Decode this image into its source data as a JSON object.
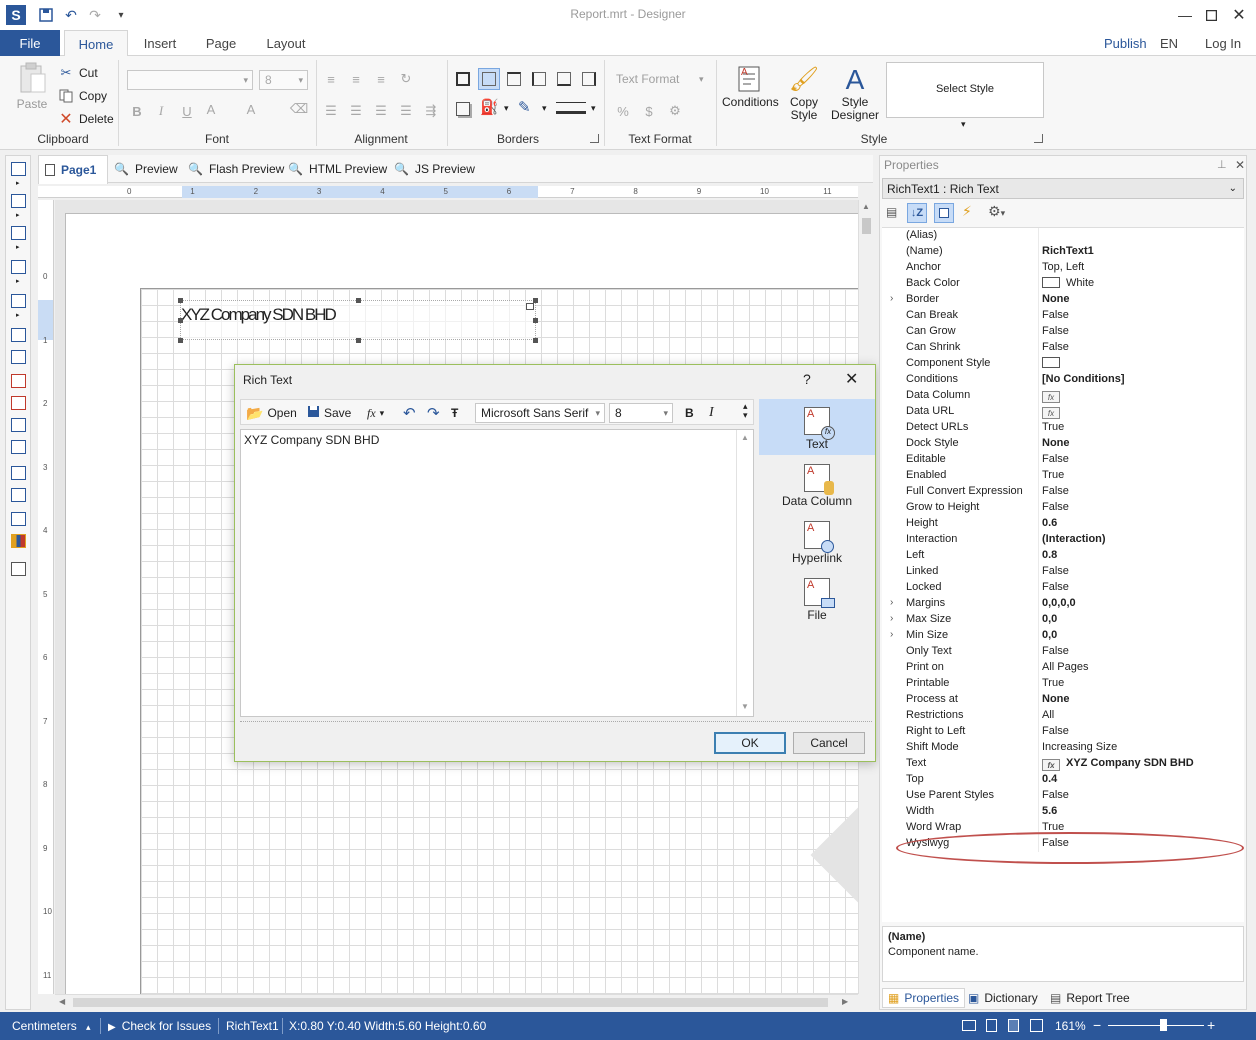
{
  "window": {
    "title": "Report.mrt - Designer"
  },
  "ribbon": {
    "file_label": "File",
    "tabs": [
      "Home",
      "Insert",
      "Page",
      "Layout"
    ],
    "right_links": [
      "Publish",
      "EN",
      "Log In"
    ],
    "clipboard": {
      "paste": "Paste",
      "cut": "Cut",
      "copy": "Copy",
      "delete": "Delete",
      "label": "Clipboard"
    },
    "font": {
      "size": "8",
      "bold": "B",
      "italic": "I",
      "underline": "U",
      "label": "Font"
    },
    "alignment": {
      "label": "Alignment"
    },
    "borders": {
      "label": "Borders"
    },
    "text_format": {
      "combo": "Text Format",
      "label": "Text Format"
    },
    "style": {
      "conditions": "Conditions",
      "copy_style": "Copy Style",
      "style_designer": "Style Designer",
      "select_style": "Select Style",
      "label": "Style"
    }
  },
  "designer_tabs": [
    "Page1",
    "Preview",
    "Flash Preview",
    "HTML Preview",
    "JS Preview"
  ],
  "ruler": {
    "h_ticks": [
      "0",
      "1",
      "2",
      "3",
      "4",
      "5",
      "6",
      "7",
      "8",
      "9",
      "10",
      "11"
    ],
    "v_ticks": [
      "0",
      "1",
      "2",
      "3",
      "4",
      "5",
      "6",
      "7",
      "8",
      "9",
      "10",
      "11"
    ]
  },
  "component_text": "XYZ Company SDN BHD",
  "dialog": {
    "title": "Rich Text",
    "help": "?",
    "toolbar": {
      "open": "Open",
      "save": "Save",
      "font_name": "Microsoft Sans Serif",
      "font_size": "8",
      "bold": "B",
      "italic": "I"
    },
    "editor_text": "XYZ Company SDN BHD",
    "sidebar": [
      "Text",
      "Data Column",
      "Hyperlink",
      "File"
    ],
    "ok": "OK",
    "cancel": "Cancel"
  },
  "properties": {
    "header": "Properties",
    "selected": "RichText1 : Rich Text",
    "rows": [
      {
        "name": "(Alias)",
        "value": ""
      },
      {
        "name": "(Name)",
        "value": "RichText1"
      },
      {
        "name": "Anchor",
        "value": "Top, Left"
      },
      {
        "name": "Back Color",
        "value": "White"
      },
      {
        "name": "Border",
        "value": "None"
      },
      {
        "name": "Can Break",
        "value": "False"
      },
      {
        "name": "Can Grow",
        "value": "False"
      },
      {
        "name": "Can Shrink",
        "value": "False"
      },
      {
        "name": "Component Style",
        "value": ""
      },
      {
        "name": "Conditions",
        "value": "[No Conditions]"
      },
      {
        "name": "Data Column",
        "value": ""
      },
      {
        "name": "Data URL",
        "value": ""
      },
      {
        "name": "Detect URLs",
        "value": "True"
      },
      {
        "name": "Dock Style",
        "value": "None"
      },
      {
        "name": "Editable",
        "value": "False"
      },
      {
        "name": "Enabled",
        "value": "True"
      },
      {
        "name": "Full Convert Expression",
        "value": "False"
      },
      {
        "name": "Grow to Height",
        "value": "False"
      },
      {
        "name": "Height",
        "value": "0.6"
      },
      {
        "name": "Interaction",
        "value": "(Interaction)"
      },
      {
        "name": "Left",
        "value": "0.8"
      },
      {
        "name": "Linked",
        "value": "False"
      },
      {
        "name": "Locked",
        "value": "False"
      },
      {
        "name": "Margins",
        "value": "0,0,0,0"
      },
      {
        "name": "Max Size",
        "value": "0,0"
      },
      {
        "name": "Min Size",
        "value": "0,0"
      },
      {
        "name": "Only Text",
        "value": "False"
      },
      {
        "name": "Print on",
        "value": "All Pages"
      },
      {
        "name": "Printable",
        "value": "True"
      },
      {
        "name": "Process at",
        "value": "None"
      },
      {
        "name": "Restrictions",
        "value": "All"
      },
      {
        "name": "Right to Left",
        "value": "False"
      },
      {
        "name": "Shift Mode",
        "value": "Increasing Size"
      },
      {
        "name": "Text",
        "value": "XYZ Company SDN BHD"
      },
      {
        "name": "Top",
        "value": "0.4"
      },
      {
        "name": "Use Parent Styles",
        "value": "False"
      },
      {
        "name": "Width",
        "value": "5.6"
      },
      {
        "name": "Word Wrap",
        "value": "True"
      },
      {
        "name": "Wysiwyg",
        "value": "False"
      }
    ],
    "desc_name": "(Name)",
    "desc_text": "Component name.",
    "bottom_tabs": [
      "Properties",
      "Dictionary",
      "Report Tree"
    ]
  },
  "status": {
    "units": "Centimeters",
    "check": "Check for Issues",
    "component": "RichText1",
    "coords": "X:0.80  Y:0.40  Width:5.60  Height:0.60",
    "zoom": "161%"
  },
  "colors": {
    "accent": "#2b579a",
    "highlight": "#c0504d"
  }
}
